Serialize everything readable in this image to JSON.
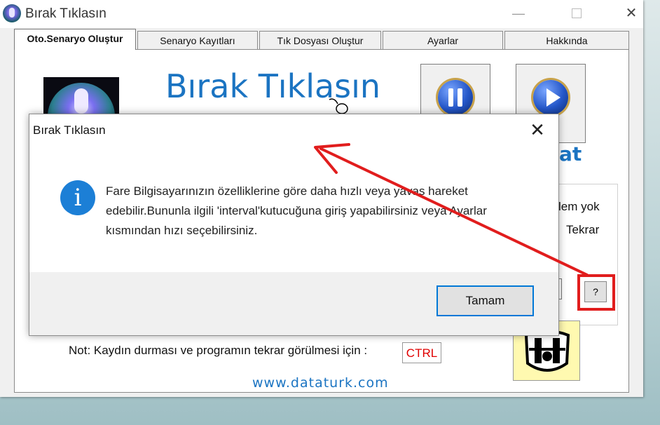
{
  "window": {
    "title": "Bırak Tıklasın",
    "min_glyph": "—",
    "close_glyph": "✕"
  },
  "tabs": [
    {
      "label": "Oto.Senaryo Oluştur",
      "active": true
    },
    {
      "label": "Senaryo Kayıtları",
      "active": false
    },
    {
      "label": "Tık Dosyası Oluştur",
      "active": false
    },
    {
      "label": "Ayarlar",
      "active": false
    },
    {
      "label": "Hakkında",
      "active": false
    }
  ],
  "main": {
    "big_title": "Bırak Tıklasın",
    "partial_label": "at",
    "partial_text_1": "lem yok",
    "partial_text_2": "Tekrar",
    "help_label": "?",
    "note": "Not: Kaydın durması ve programın tekrar görülmesi için :",
    "ctrl_value": "CTRL",
    "website": "www.dataturk.com"
  },
  "dialog": {
    "title": "Bırak Tıklasın",
    "close_glyph": "✕",
    "icon_glyph": "i",
    "message": "Fare Bilgisayarınızın özelliklerine göre daha hızlı veya yavaş hareket edebilir.Bununla ilgili 'interval'kutucuğuna giriş yapabilirsiniz veya Ayarlar kısmından hızı seçebilirsiniz.",
    "ok_label": "Tamam"
  },
  "colors": {
    "accent_blue": "#1b74c2",
    "annotation_red": "#e11d1d",
    "ctrl_red": "#e00000"
  }
}
